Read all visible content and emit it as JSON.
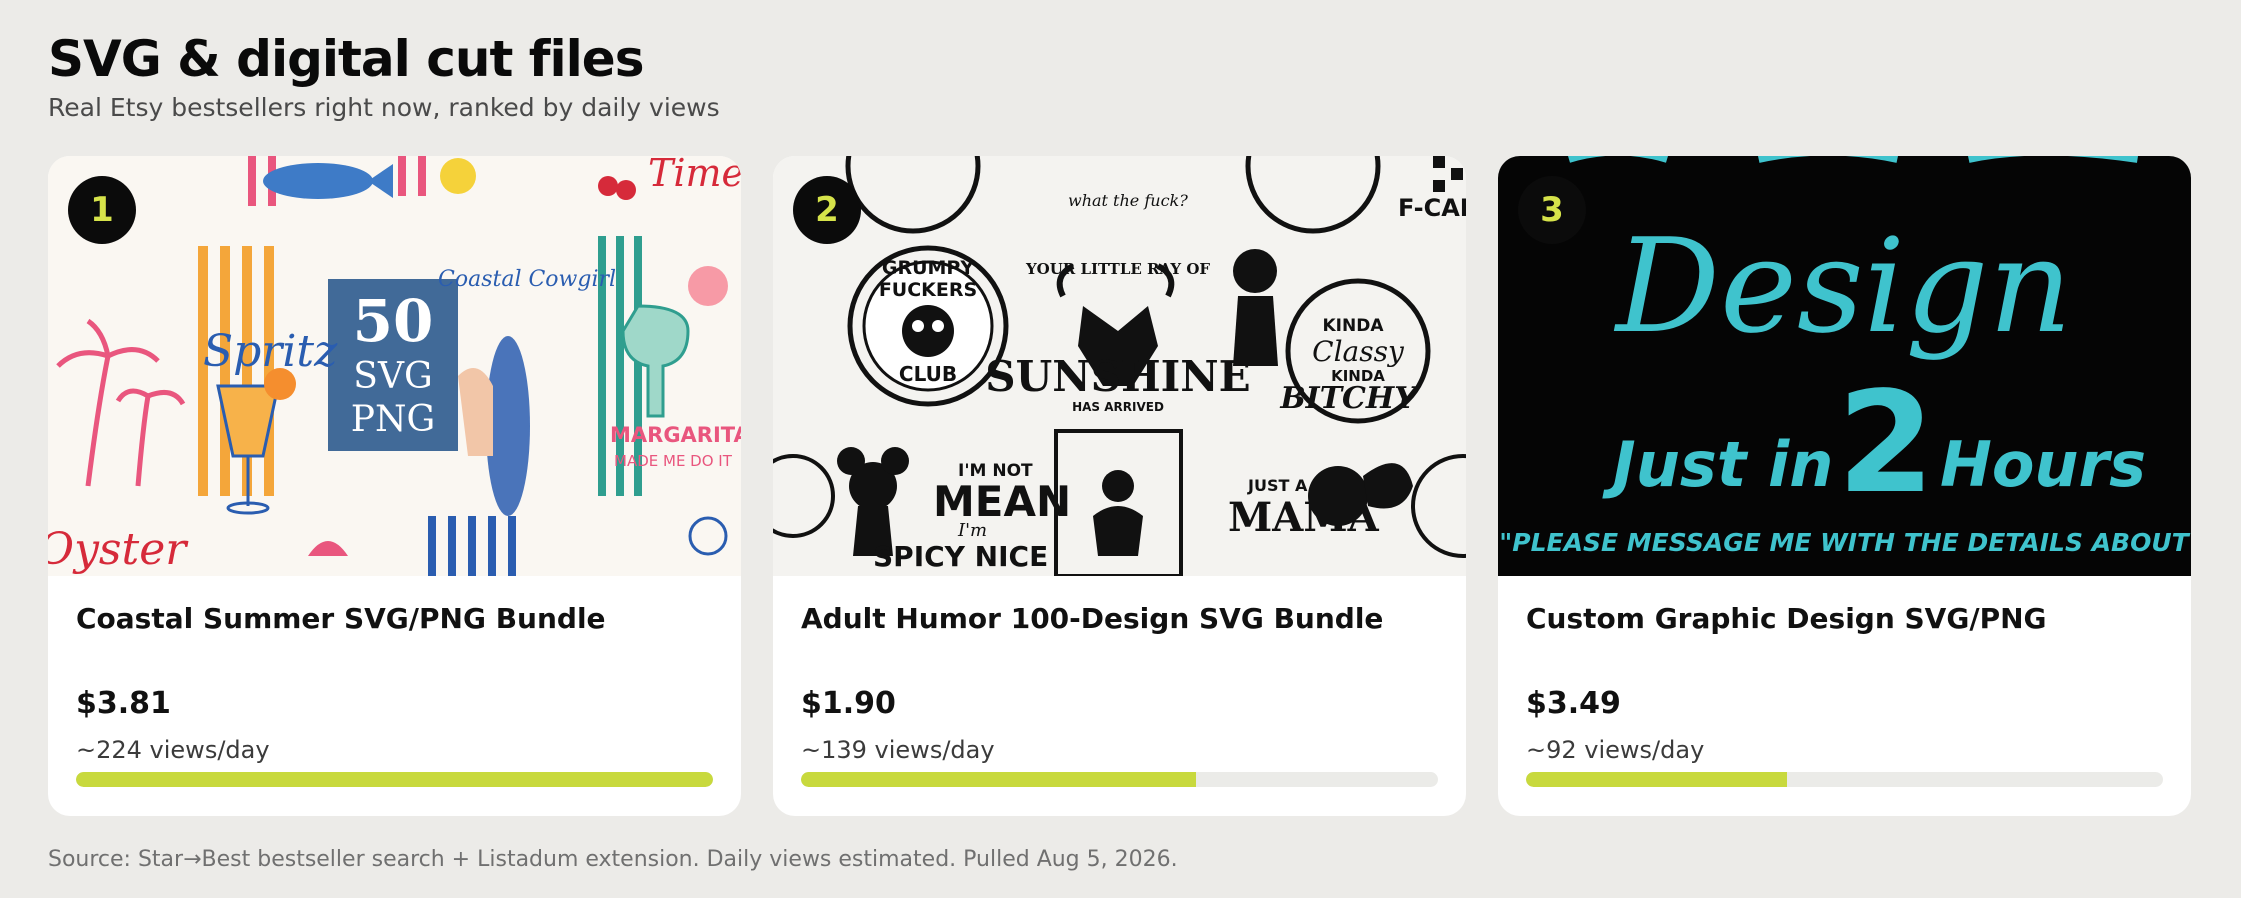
{
  "header": {
    "title": "SVG & digital cut files",
    "subtitle": "Real Etsy bestsellers right now, ranked by daily views"
  },
  "cards": [
    {
      "rank": "1",
      "name": "Coastal Summer SVG/PNG Bundle",
      "price": "$3.81",
      "views": "~224 views/day",
      "views_fraction": 1.0,
      "thumb_text": {
        "big": "50",
        "mid": "SVG",
        "low": "PNG",
        "script": "Spritz",
        "word1": "Time",
        "word2": "MARGARITAS",
        "word3": "MADE ME DO IT",
        "word4": "Oyster",
        "word5": "Coastal Cowgirl"
      }
    },
    {
      "rank": "2",
      "name": "Adult Humor 100-Design SVG Bundle",
      "price": "$1.90",
      "views": "~139 views/day",
      "views_fraction": 0.62,
      "thumb_text": {
        "b1": "GRUMPY",
        "b2": "FUCKERS",
        "b3": "CLUB",
        "s1": "YOUR LITTLE RAY OF",
        "s2": "SUNSHINE",
        "s3": "HAS ARRIVED",
        "k1": "KINDA",
        "k2": "Classy",
        "k3": "KINDA",
        "k4": "BITCHY",
        "m1": "I'M NOT",
        "m2": "MEAN",
        "m3": "I'm",
        "m4": "SPICY NICE",
        "j1": "JUST A",
        "j2": "MAMA",
        "t1": "what the fuck?",
        "t2": "F-CAN"
      }
    },
    {
      "rank": "3",
      "name": "Custom Graphic Design SVG/PNG",
      "price": "$3.49",
      "views": "~92 views/day",
      "views_fraction": 0.41,
      "thumb_text": {
        "script": "Design",
        "line1a": "Just in",
        "line1b": "2",
        "line1c": "Hours",
        "line2": "\"PLEASE MESSAGE ME WITH THE DETAILS ABOUT"
      }
    }
  ],
  "footer": "Source: Star→Best bestseller search + Listadum extension. Daily views estimated. Pulled Aug 5, 2026.",
  "colors": {
    "accent": "#c8d93d",
    "rank_bg": "#0b0b0b",
    "rank_text": "#d6e34a",
    "teal": "#3fc3cd"
  }
}
